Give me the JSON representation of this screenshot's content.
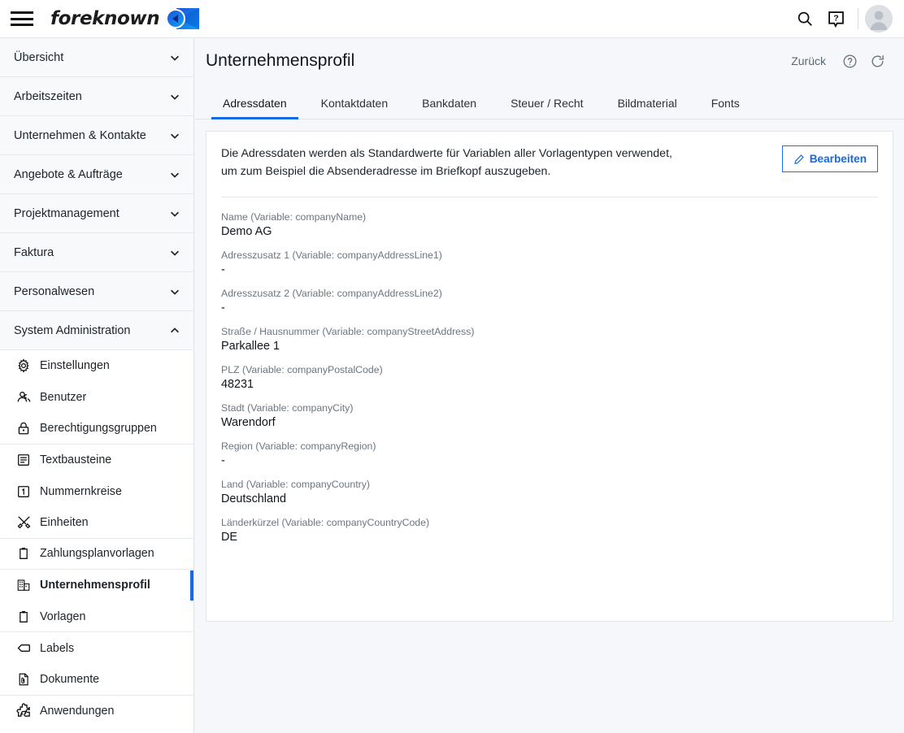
{
  "topbar": {
    "menu_icon": "hamburger-icon",
    "brand_text": "foreknown",
    "brand_mark": "foreknown-logo-mark",
    "search_icon": "search-icon",
    "help_icon": "help-speech-bubble-icon",
    "avatar": "user-avatar"
  },
  "sidebar": {
    "groups": [
      {
        "label": "Übersicht",
        "expanded": false,
        "chevron": "chevron-down-icon"
      },
      {
        "label": "Arbeitszeiten",
        "expanded": false,
        "chevron": "chevron-down-icon"
      },
      {
        "label": "Unternehmen & Kontakte",
        "expanded": false,
        "chevron": "chevron-down-icon"
      },
      {
        "label": "Angebote & Aufträge",
        "expanded": false,
        "chevron": "chevron-down-icon"
      },
      {
        "label": "Projektmanagement",
        "expanded": false,
        "chevron": "chevron-down-icon"
      },
      {
        "label": "Faktura",
        "expanded": false,
        "chevron": "chevron-down-icon"
      },
      {
        "label": "Personalwesen",
        "expanded": false,
        "chevron": "chevron-down-icon"
      },
      {
        "label": "System Administration",
        "expanded": true,
        "chevron": "chevron-up-icon"
      }
    ],
    "items": [
      {
        "label": "Einstellungen",
        "icon": "gear-icon",
        "active": false
      },
      {
        "label": "Benutzer",
        "icon": "users-icon",
        "active": false
      },
      {
        "label": "Berechtigungsgruppen",
        "icon": "lock-icon",
        "active": false
      },
      {
        "label": "Textbausteine",
        "icon": "text-block-icon",
        "active": false
      },
      {
        "label": "Nummernkreise",
        "icon": "number-box-icon",
        "active": false
      },
      {
        "label": "Einheiten",
        "icon": "tools-icon",
        "active": false
      },
      {
        "label": "Zahlungsplanvorlagen",
        "icon": "clipboard-icon",
        "active": false
      },
      {
        "label": "Unternehmensprofil",
        "icon": "building-icon",
        "active": true
      },
      {
        "label": "Vorlagen",
        "icon": "clipboard-icon",
        "active": false
      },
      {
        "label": "Labels",
        "icon": "tag-icon",
        "active": false
      },
      {
        "label": "Dokumente",
        "icon": "document-icon",
        "active": false
      },
      {
        "label": "Anwendungen",
        "icon": "puzzle-icon",
        "active": false
      }
    ]
  },
  "page": {
    "title": "Unternehmensprofil",
    "back_label": "Zurück",
    "help_icon": "help-circle-icon",
    "refresh_icon": "refresh-icon"
  },
  "tabs": [
    {
      "label": "Adressdaten",
      "active": true
    },
    {
      "label": "Kontaktdaten",
      "active": false
    },
    {
      "label": "Bankdaten",
      "active": false
    },
    {
      "label": "Steuer / Recht",
      "active": false
    },
    {
      "label": "Bildmaterial",
      "active": false
    },
    {
      "label": "Fonts",
      "active": false
    }
  ],
  "card": {
    "description": "Die Adressdaten werden als Standardwerte für Variablen aller Vorlagentypen verwendet, um zum Beispiel die Absenderadresse im Briefkopf auszugeben.",
    "edit_label": "Bearbeiten",
    "edit_icon": "pencil-icon",
    "fields": [
      {
        "label": "Name (Variable: companyName)",
        "value": "Demo AG"
      },
      {
        "label": "Adresszusatz 1 (Variable: companyAddressLine1)",
        "value": "-"
      },
      {
        "label": "Adresszusatz 2 (Variable: companyAddressLine2)",
        "value": "-"
      },
      {
        "label": "Straße / Hausnummer (Variable: companyStreetAddress)",
        "value": "Parkallee 1"
      },
      {
        "label": "PLZ (Variable: companyPostalCode)",
        "value": "48231"
      },
      {
        "label": "Stadt (Variable: companyCity)",
        "value": "Warendorf"
      },
      {
        "label": "Region (Variable: companyRegion)",
        "value": "-"
      },
      {
        "label": "Land (Variable: companyCountry)",
        "value": "Deutschland"
      },
      {
        "label": "Länderkürzel (Variable: companyCountryCode)",
        "value": "DE"
      }
    ]
  },
  "colors": {
    "accent": "#1668e3",
    "page_bg": "#f5f7fa",
    "surface": "#ffffff",
    "border": "#e2e6ea",
    "text": "#10161c",
    "muted": "#6b7680"
  }
}
